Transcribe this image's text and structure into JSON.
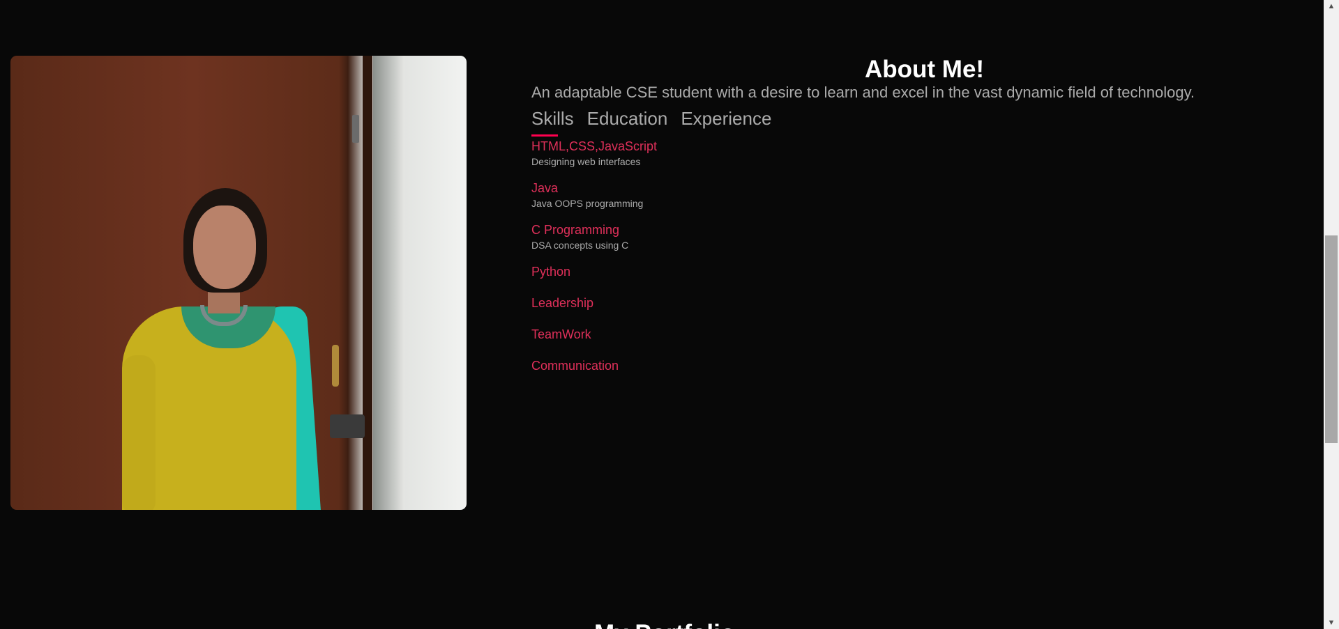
{
  "about": {
    "title": "About Me!",
    "description": "An adaptable CSE student with a desire to learn and excel in the vast dynamic field of technology."
  },
  "tabs": [
    {
      "label": "Skills",
      "active": true
    },
    {
      "label": "Education",
      "active": false
    },
    {
      "label": "Experience",
      "active": false
    }
  ],
  "skills": [
    {
      "name": "HTML,CSS,JavaScript",
      "desc": "Designing web interfaces"
    },
    {
      "name": "Java",
      "desc": "Java OOPS programming"
    },
    {
      "name": "C Programming",
      "desc": "DSA concepts using C"
    },
    {
      "name": "Python"
    },
    {
      "name": "Leadership"
    },
    {
      "name": "TeamWork"
    },
    {
      "name": "Communication"
    }
  ],
  "next_section": {
    "title": "My Portfolio"
  },
  "colors": {
    "background": "#080808",
    "accent": "#ff004f",
    "skill_text": "#e0305a",
    "text": "#ababab"
  },
  "icons": {
    "scroll_up": "chevron-up-icon",
    "scroll_down": "chevron-down-icon"
  }
}
